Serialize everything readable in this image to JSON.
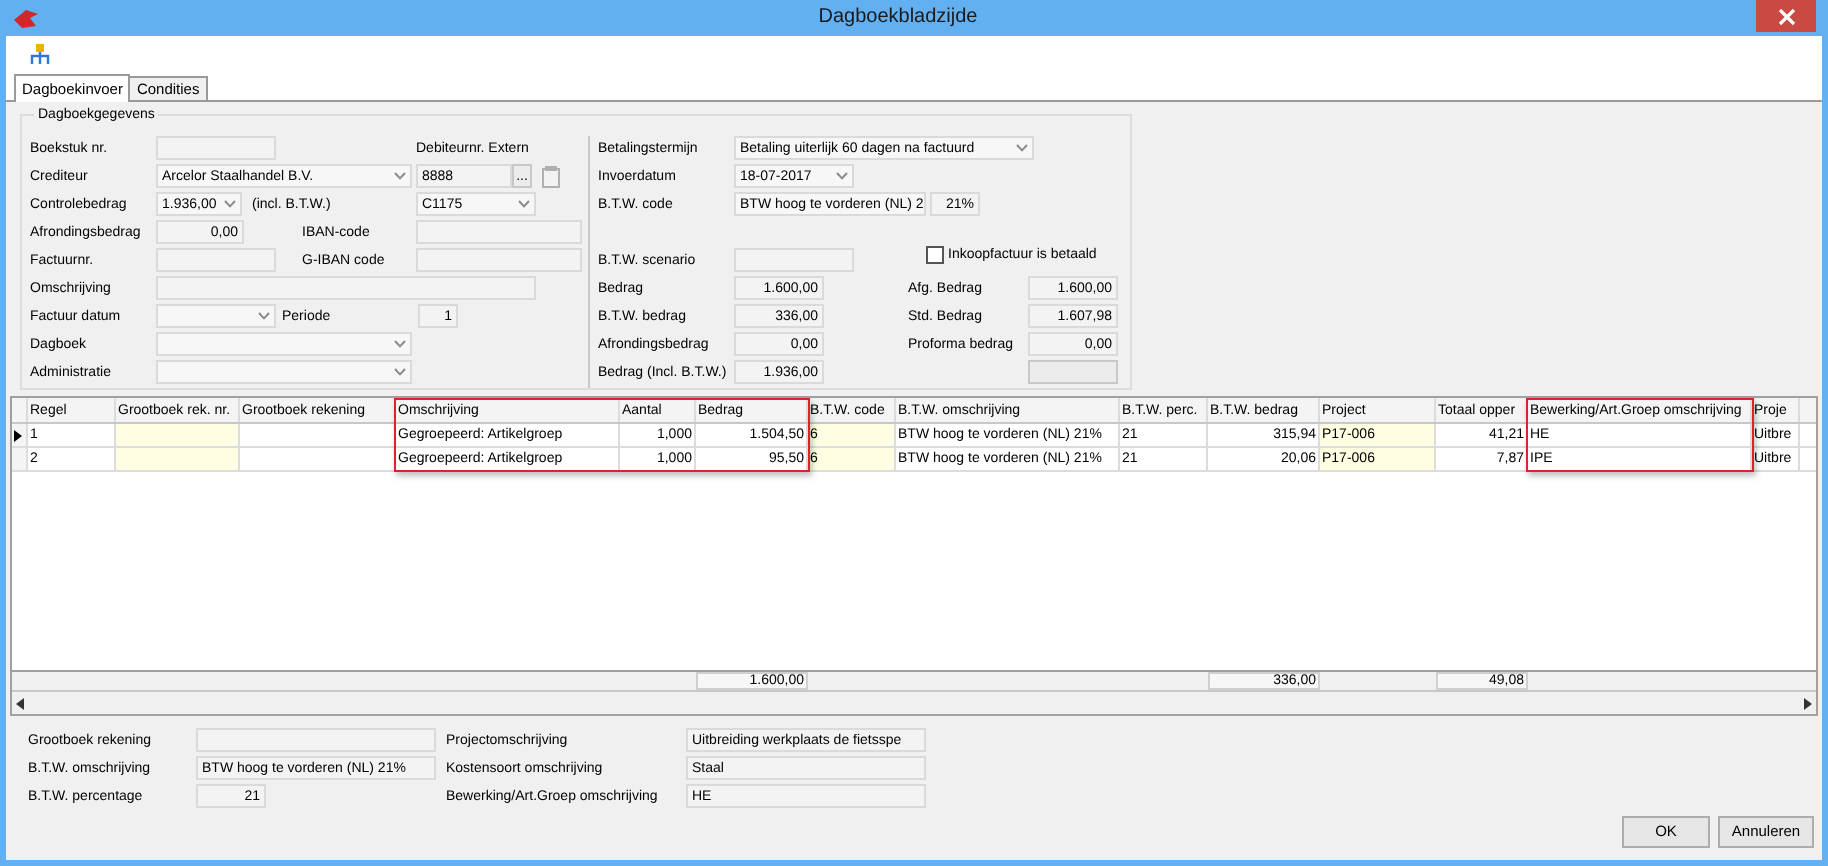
{
  "window": {
    "title": "Dagboekbladzijde"
  },
  "tabs": [
    {
      "label": "Dagboekinvoer",
      "selected": true
    },
    {
      "label": "Condities",
      "selected": false
    }
  ],
  "group": {
    "title": "Dagboekgegevens"
  },
  "form": {
    "boekstuk_nr": {
      "label": "Boekstuk nr."
    },
    "debiteurnr_extern": {
      "label": "Debiteurnr. Extern"
    },
    "crediteur": {
      "label": "Crediteur",
      "value": "Arcelor Staalhandel B.V."
    },
    "debiteurnr": {
      "value": "8888",
      "button": "..."
    },
    "controlebedrag": {
      "label": "Controlebedrag",
      "value": "1.936,00",
      "suffix": "(incl. B.T.W.)"
    },
    "debiteur_code": {
      "value": "C1175"
    },
    "afrondingsbedrag": {
      "label": "Afrondingsbedrag",
      "value": "0,00"
    },
    "iban": {
      "label": "IBAN-code"
    },
    "factuurnr": {
      "label": "Factuurnr."
    },
    "g_iban": {
      "label": "G-IBAN code"
    },
    "omschrijving": {
      "label": "Omschrijving"
    },
    "factuur_datum": {
      "label": "Factuur datum"
    },
    "periode": {
      "label": "Periode",
      "value": "1"
    },
    "dagboek": {
      "label": "Dagboek"
    },
    "administratie": {
      "label": "Administratie"
    },
    "betalingstermijn": {
      "label": "Betalingstermijn",
      "value": "Betaling uiterlijk 60 dagen na factuurd"
    },
    "invoerdatum": {
      "label": "Invoerdatum",
      "value": "18-07-2017"
    },
    "btw_code": {
      "label": "B.T.W. code",
      "value": "BTW hoog te vorderen (NL) 2",
      "percentage": "21%"
    },
    "inkoopfactuur_betaald": {
      "label": "Inkoopfactuur is betaald",
      "checked": false
    },
    "btw_scenario": {
      "label": "B.T.W. scenario"
    },
    "bedrag": {
      "label": "Bedrag",
      "value": "1.600,00"
    },
    "btw_bedrag": {
      "label": "B.T.W. bedrag",
      "value": "336,00"
    },
    "afrondingsbedrag_2": {
      "label": "Afrondingsbedrag",
      "value": "0,00"
    },
    "bedrag_incl": {
      "label": "Bedrag (Incl. B.T.W.)",
      "value": "1.936,00"
    },
    "afg_bedrag": {
      "label": "Afg. Bedrag",
      "value": "1.600,00"
    },
    "std_bedrag": {
      "label": "Std. Bedrag",
      "value": "1.607,98"
    },
    "proforma_bedrag": {
      "label": "Proforma bedrag",
      "value": "0,00"
    }
  },
  "table": {
    "columns": [
      {
        "label": "Regel",
        "kind": "text"
      },
      {
        "label": "Grootboek rek. nr.",
        "kind": "text",
        "editable": true
      },
      {
        "label": "Grootboek rekening",
        "kind": "text"
      },
      {
        "label": "Omschrijving",
        "kind": "text",
        "highlighted": true
      },
      {
        "label": "Aantal",
        "kind": "number",
        "highlighted": true
      },
      {
        "label": "Bedrag",
        "kind": "number",
        "highlighted": true,
        "total": "1.600,00"
      },
      {
        "label": "B.T.W. code",
        "kind": "text",
        "editable": true
      },
      {
        "label": "B.T.W. omschrijving",
        "kind": "text"
      },
      {
        "label": "B.T.W. perc.",
        "kind": "text"
      },
      {
        "label": "B.T.W. bedrag",
        "kind": "number",
        "total": "336,00"
      },
      {
        "label": "Project",
        "kind": "text",
        "editable": true
      },
      {
        "label": "Totaal opper",
        "kind": "number",
        "total": "49,08"
      },
      {
        "label": "Bewerking/Art.Groep omschrijving",
        "kind": "text",
        "highlighted": true
      },
      {
        "label": "Proje",
        "kind": "text"
      }
    ],
    "rows": [
      {
        "selected": true,
        "cells": [
          "1",
          null,
          null,
          "Gegroepeerd: Artikelgroep",
          "1,000",
          "1.504,50",
          "6",
          "BTW hoog te vorderen (NL) 21%",
          "21",
          "315,94",
          "P17-006",
          "41,21",
          "HE",
          "Uitbre"
        ]
      },
      {
        "selected": false,
        "cells": [
          "2",
          null,
          null,
          "Gegroepeerd: Artikelgroep",
          "1,000",
          "95,50",
          "6",
          "BTW hoog te vorderen (NL) 21%",
          "21",
          "20,06",
          "P17-006",
          "7,87",
          "IPE",
          "Uitbre"
        ]
      }
    ]
  },
  "details": {
    "grootboek_rekening": {
      "label": "Grootboek rekening"
    },
    "btw_omschrijving": {
      "label": "B.T.W. omschrijving",
      "value": "BTW hoog te vorderen (NL) 21%"
    },
    "btw_percentage": {
      "label": "B.T.W. percentage",
      "value": "21"
    },
    "projectomschrijving": {
      "label": "Projectomschrijving",
      "value": "Uitbreiding werkplaats de fietsspe"
    },
    "kostensoort": {
      "label": "Kostensoort omschrijving",
      "value": "Staal"
    },
    "bewerking": {
      "label": "Bewerking/Art.Groep omschrijving",
      "value": "HE"
    }
  },
  "buttons": [
    {
      "label": "OK"
    },
    {
      "label": "Annuleren"
    }
  ]
}
